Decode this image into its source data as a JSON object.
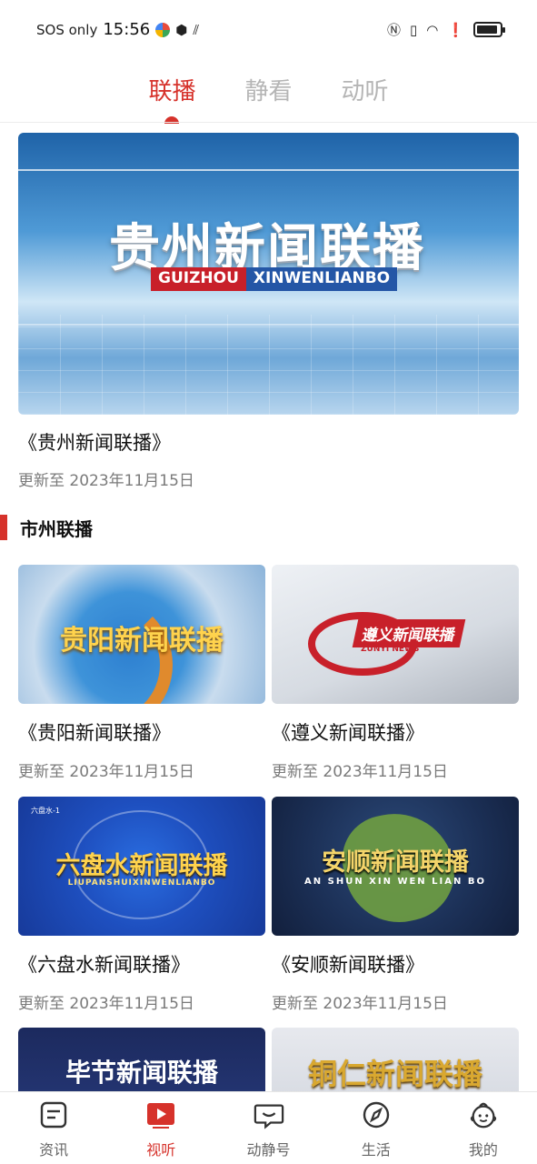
{
  "status_bar": {
    "carrier": "SOS only",
    "time": "15:56"
  },
  "top_tabs": [
    {
      "label": "联播",
      "active": true
    },
    {
      "label": "静看",
      "active": false
    },
    {
      "label": "动听",
      "active": false
    }
  ],
  "hero": {
    "thumb_text_cn": "贵州新闻联播",
    "thumb_text_en_a": "GUIZHOU",
    "thumb_text_en_b": "XINWENLIANBO",
    "title": "《贵州新闻联播》",
    "date": "更新至 2023年11月15日"
  },
  "section": {
    "title": "市州联播"
  },
  "cards": [
    {
      "thumb_text": "贵阳新闻联播",
      "title": "《贵阳新闻联播》",
      "date": "更新至 2023年11月15日"
    },
    {
      "thumb_text": "遵义新闻联播",
      "thumb_sub": "ZUNYI NEWS",
      "title": "《遵义新闻联播》",
      "date": "更新至 2023年11月15日"
    },
    {
      "thumb_text": "六盘水新闻联播",
      "thumb_sub": "LIUPANSHUIXINWENLIANBO",
      "thumb_corner": "六盘水-1",
      "title": "《六盘水新闻联播》",
      "date": "更新至 2023年11月15日"
    },
    {
      "thumb_text": "安顺新闻联播",
      "thumb_sub": "AN SHUN XIN WEN LIAN BO",
      "title": "《安顺新闻联播》",
      "date": "更新至 2023年11月15日"
    },
    {
      "thumb_text": "毕节新闻联播"
    },
    {
      "thumb_text": "铜仁新闻联播"
    }
  ],
  "bottom_nav": [
    {
      "label": "资讯",
      "icon": "news-icon",
      "active": false
    },
    {
      "label": "视听",
      "icon": "video-play-icon",
      "active": true
    },
    {
      "label": "动静号",
      "icon": "chat-smile-icon",
      "active": false
    },
    {
      "label": "生活",
      "icon": "compass-icon",
      "active": false
    },
    {
      "label": "我的",
      "icon": "profile-avatar-icon",
      "active": false
    }
  ],
  "colors": {
    "accent": "#d6322b",
    "inactive_tab": "#b5b5b5",
    "secondary_text": "#7a7a7a"
  }
}
